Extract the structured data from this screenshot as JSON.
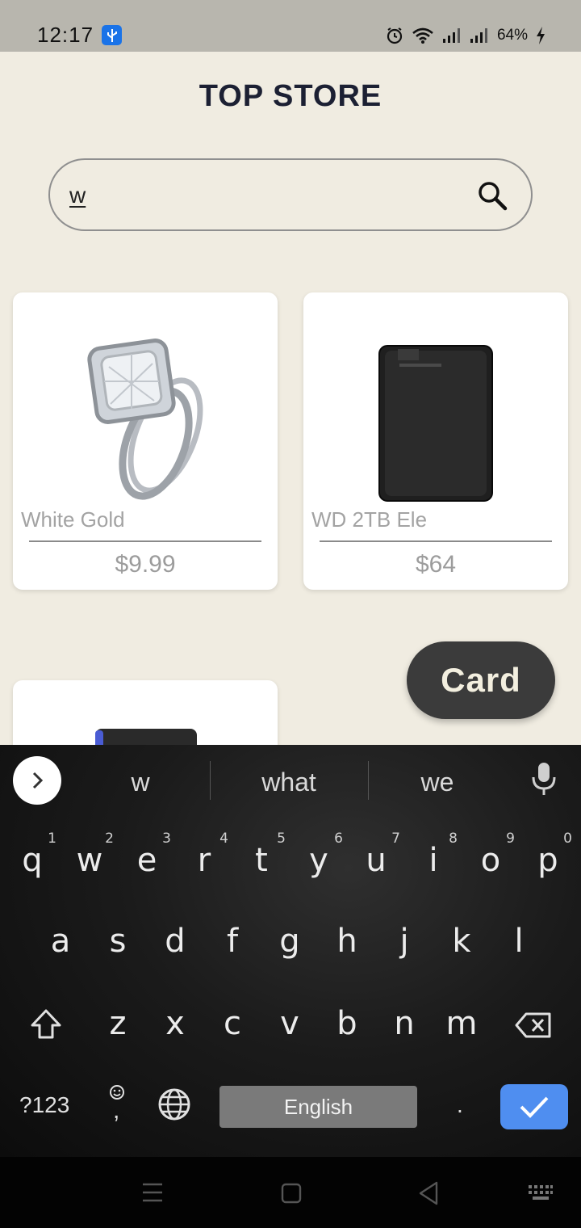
{
  "status_bar": {
    "time": "12:17",
    "battery": "64%"
  },
  "app": {
    "title": "TOP STORE",
    "search": {
      "value": "w"
    },
    "products": [
      {
        "name": "White Gold",
        "price": "$9.99",
        "image": "diamond-ring"
      },
      {
        "name": "WD 2TB Ele",
        "price": "$64",
        "image": "external-hard-drive"
      },
      {
        "name": "",
        "price": "",
        "image": "portable-ssd"
      }
    ],
    "card_button": "Card"
  },
  "keyboard": {
    "suggestions": [
      "w",
      "what",
      "we"
    ],
    "row1": [
      {
        "k": "q",
        "h": "1"
      },
      {
        "k": "w",
        "h": "2"
      },
      {
        "k": "e",
        "h": "3"
      },
      {
        "k": "r",
        "h": "4"
      },
      {
        "k": "t",
        "h": "5"
      },
      {
        "k": "y",
        "h": "6"
      },
      {
        "k": "u",
        "h": "7"
      },
      {
        "k": "i",
        "h": "8"
      },
      {
        "k": "o",
        "h": "9"
      },
      {
        "k": "p",
        "h": "0"
      }
    ],
    "row2": [
      "a",
      "s",
      "d",
      "f",
      "g",
      "h",
      "j",
      "k",
      "l"
    ],
    "row3": [
      "z",
      "x",
      "c",
      "v",
      "b",
      "n",
      "m"
    ],
    "symbols_label": "?123",
    "comma_label": ",",
    "space_label": "English",
    "period_label": "."
  }
}
